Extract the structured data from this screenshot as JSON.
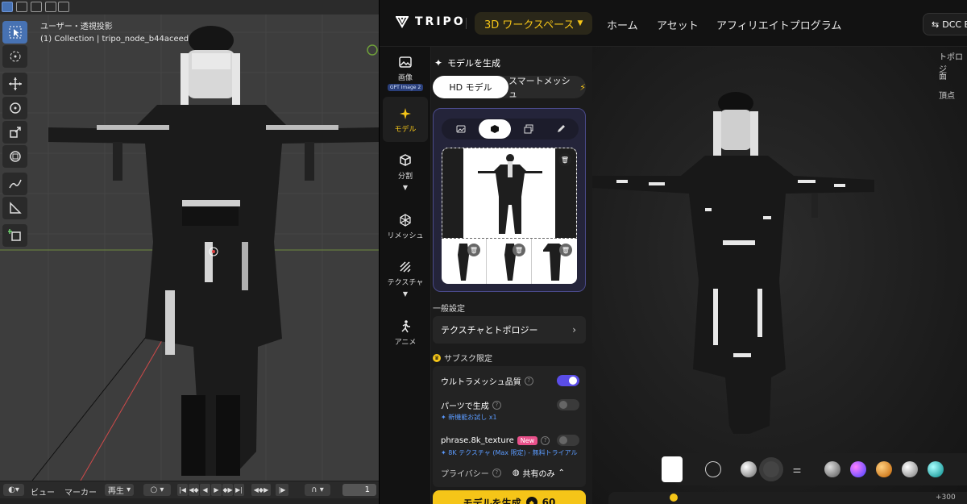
{
  "blender": {
    "viewport_title": "ユーザー・透視投影",
    "collection_info": "(1) Collection | tripo_node_b44aceed",
    "timeline": {
      "menu_view": "ビュー",
      "menu_marker": "マーカー",
      "playback": "再生",
      "frame": "1"
    }
  },
  "tripo": {
    "logo": "TRIPO",
    "workspace": "3D ワークスペース",
    "nav": [
      "ホーム",
      "アセット",
      "アフィリエイトプログラム"
    ],
    "dcc_button": "DCC B",
    "sidebar": [
      {
        "label": "画像",
        "badge": "GPT Image 2"
      },
      {
        "label": "モデル"
      },
      {
        "label": "分割"
      },
      {
        "label": "リメッシュ"
      },
      {
        "label": "テクスチャ"
      },
      {
        "label": "アニメ"
      }
    ],
    "panel": {
      "title": "モデルを生成",
      "mode_hd": "HD モデル",
      "mode_smart": "スマートメッシュ",
      "general_settings": "一般設定",
      "texture_topology": "テクスチャとトポロジー",
      "subscription_label": "サブスク限定",
      "options": [
        {
          "label": "ウルトラメッシュ品質",
          "on": true
        },
        {
          "label": "パーツで生成",
          "on": false,
          "note": "新機能お試し x1"
        },
        {
          "label": "phrase.8k_texture",
          "badge": "New",
          "on": false,
          "note": "8K テクスチャ (Max 限定) - 無料トライアル"
        }
      ],
      "privacy_label": "プライバシー",
      "privacy_value": "共有のみ",
      "generate_button": "モデルを生成",
      "generate_cost": "60"
    },
    "stats": [
      "トポロジ",
      "面",
      "頂点"
    ],
    "viewport_bottom_value": "+300"
  },
  "colors": {
    "accent_yellow": "#f5c518",
    "toggle_on": "#5a4de8",
    "blender_active": "#4772b3"
  }
}
